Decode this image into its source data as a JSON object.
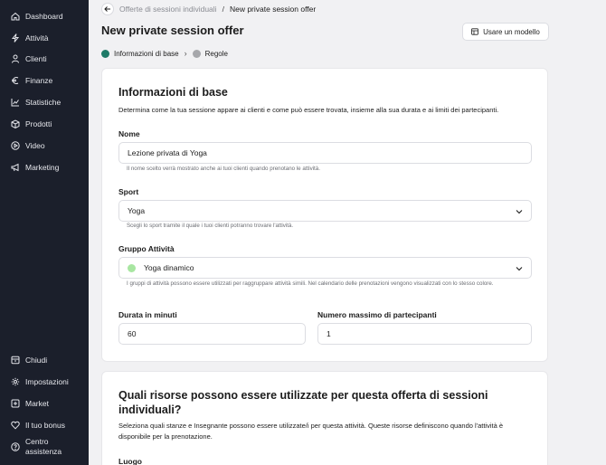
{
  "sidebar": {
    "items": [
      {
        "label": "Dashboard",
        "icon": "home-icon"
      },
      {
        "label": "Attività",
        "icon": "bolt-icon"
      },
      {
        "label": "Clienti",
        "icon": "user-icon"
      },
      {
        "label": "Finanze",
        "icon": "euro-icon"
      },
      {
        "label": "Statistiche",
        "icon": "chart-line-icon"
      },
      {
        "label": "Prodotti",
        "icon": "box-icon"
      },
      {
        "label": "Video",
        "icon": "play-icon"
      },
      {
        "label": "Marketing",
        "icon": "megaphone-icon"
      }
    ],
    "bottom_items": [
      {
        "label": "Chiudi",
        "icon": "archive-icon"
      },
      {
        "label": "Impostazioni",
        "icon": "gear-icon"
      },
      {
        "label": "Market",
        "icon": "plus-square-icon"
      },
      {
        "label": "Il tuo bonus",
        "icon": "heart-icon"
      },
      {
        "label": "Centro assistenza",
        "icon": "help-icon"
      }
    ]
  },
  "breadcrumb": {
    "previous": "Offerte di sessioni individuali",
    "separator": "/",
    "current": "New private session offer"
  },
  "page_title": "New private session offer",
  "template_button": "Usare un modello",
  "steps": [
    {
      "label": "Informazioni di base",
      "state": "active"
    },
    {
      "label": "Regole",
      "state": "inactive"
    }
  ],
  "basic_info": {
    "title": "Informazioni di base",
    "description": "Determina come la tua sessione appare ai clienti e come può essere trovata, insieme alla sua durata e ai limiti dei partecipanti.",
    "name": {
      "label": "Nome",
      "value": "Lezione privata di Yoga",
      "hint": "Il nome scelto verrà mostrato anche ai tuoi clienti quando prenotano le attività."
    },
    "sport": {
      "label": "Sport",
      "value": "Yoga",
      "hint": "Scegli lo sport tramite il quale i tuoi clienti potranno trovare l'attività."
    },
    "group": {
      "label": "Gruppo Attività",
      "value": "Yoga dinamico",
      "color": "#a8e6a1",
      "hint": "I gruppi di attività possono essere utilizzati per raggruppare attività simili. Nel calendario delle prenotazioni vengono visualizzati con lo stesso colore."
    },
    "duration": {
      "label": "Durata in minuti",
      "value": "60"
    },
    "max_participants": {
      "label": "Numero massimo di partecipanti",
      "value": "1"
    }
  },
  "resources": {
    "title": "Quali risorse possono essere utilizzate per questa offerta di sessioni individuali?",
    "description": "Seleziona quali stanze e Insegnante possono essere utilizzate/i per questa attività. Queste risorse definiscono quando l'attività è disponibile per la prenotazione.",
    "location_label": "Luogo"
  },
  "colors": {
    "sidebar_bg": "#1b1f2b",
    "page_bg": "#f1f1f3",
    "active_step": "#1e7a67"
  }
}
